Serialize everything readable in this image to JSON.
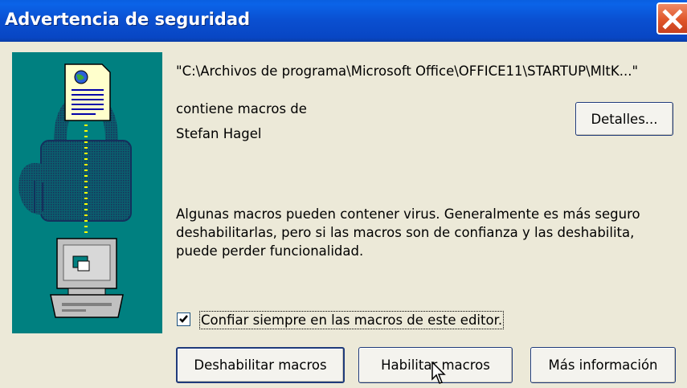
{
  "window": {
    "title": "Advertencia de seguridad"
  },
  "file": {
    "path": "\"C:\\Archivos de programa\\Microsoft Office\\OFFICE11\\STARTUP\\MltK...\""
  },
  "publisher": {
    "contains_label": "contiene macros de",
    "name": "Stefan Hagel"
  },
  "buttons": {
    "details": "Detalles...",
    "disable_macros": "Deshabilitar macros",
    "enable_macros": "Habilitar macros",
    "more_info": "Más información"
  },
  "warning": {
    "text": "Algunas macros pueden contener virus. Generalmente es más seguro deshabilitarlas, pero si las macros son de confianza y las deshabilita, puede perder funcionalidad."
  },
  "checkbox": {
    "label": "Confiar siempre en las macros de este editor.",
    "checked": true
  },
  "colors": {
    "titlebar": "#0a4fd0",
    "dialog_bg": "#ece9d8",
    "illustration_bg": "#008080",
    "close_button": "#e0562a"
  },
  "icons": [
    "close-icon",
    "document-icon",
    "padlock-icon",
    "computer-icon",
    "checkmark-icon",
    "mouse-cursor-icon"
  ]
}
